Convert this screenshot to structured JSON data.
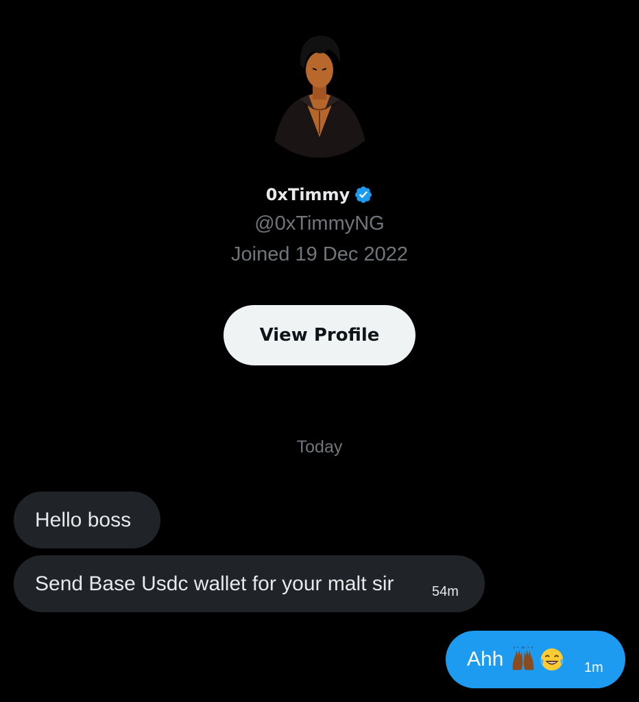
{
  "profile": {
    "display_name": "0xTimmy",
    "handle": "@0xTimmyNG",
    "joined": "Joined 19 Dec 2022",
    "view_profile_label": "View Profile"
  },
  "chat": {
    "date_separator": "Today",
    "messages": [
      {
        "direction": "incoming",
        "text": "Hello boss",
        "time": ""
      },
      {
        "direction": "incoming",
        "text": "Send Base Usdc wallet for your malt sir",
        "time": "54m"
      },
      {
        "direction": "outgoing",
        "text": "Ahh",
        "time": "1m",
        "emoji": [
          "raising-hands-emoji",
          "tears-of-joy-emoji"
        ]
      }
    ]
  },
  "colors": {
    "background": "#000000",
    "incoming_bubble": "#202327",
    "outgoing_bubble": "#1d9bf0",
    "muted_text": "#71767b",
    "verified_badge": "#1d9bf0"
  },
  "icons": [
    "avatar-image",
    "verified-badge-icon",
    "raising-hands-emoji",
    "tears-of-joy-emoji"
  ]
}
